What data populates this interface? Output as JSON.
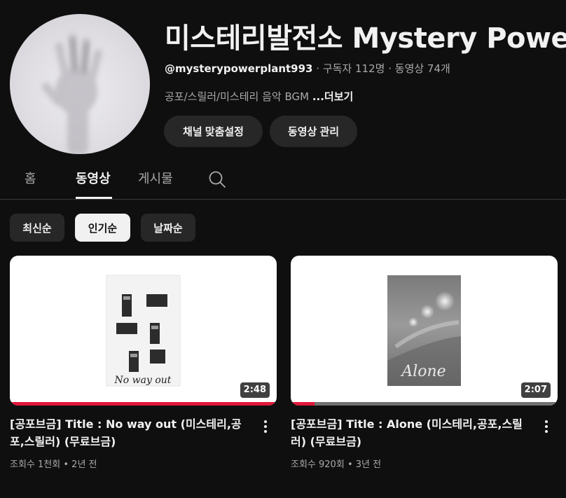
{
  "channel": {
    "title": "미스테리발전소 Mystery Power",
    "handle": "@mysterypowerplant993",
    "subscribers": "구독자 112명",
    "video_count": "동영상 74개",
    "description": "공포/스릴러/미스테리 음악 BGM",
    "more_label": "...더보기",
    "customize_label": "채널 맞춤설정",
    "manage_label": "동영상 관리"
  },
  "tabs": [
    {
      "label": "홈",
      "active": false
    },
    {
      "label": "동영상",
      "active": true
    },
    {
      "label": "게시물",
      "active": false
    }
  ],
  "chips": [
    {
      "label": "최신순",
      "selected": false
    },
    {
      "label": "인기순",
      "selected": true
    },
    {
      "label": "날짜순",
      "selected": false
    }
  ],
  "videos": [
    {
      "title": "[공포브금] Title : No way out (미스테리,공포,스릴러) (무료브금)",
      "views": "조회수 1천회",
      "age": "2년 전",
      "duration": "2:48",
      "watched_fraction": 1.0,
      "thumb_caption": "No way out"
    },
    {
      "title": "[공포브금] Title : Alone (미스테리,공포,스릴러) (무료브금)",
      "views": "조회수 920회",
      "age": "3년 전",
      "duration": "2:07",
      "watched_fraction": 0.09,
      "thumb_caption": "Alone"
    }
  ],
  "colors": {
    "background": "#0f0f0f",
    "chip_bg": "#272727",
    "progress": "#e2173b",
    "text_secondary": "#aaaaaa"
  },
  "icons": [
    "search-icon",
    "more-vert-icon"
  ]
}
